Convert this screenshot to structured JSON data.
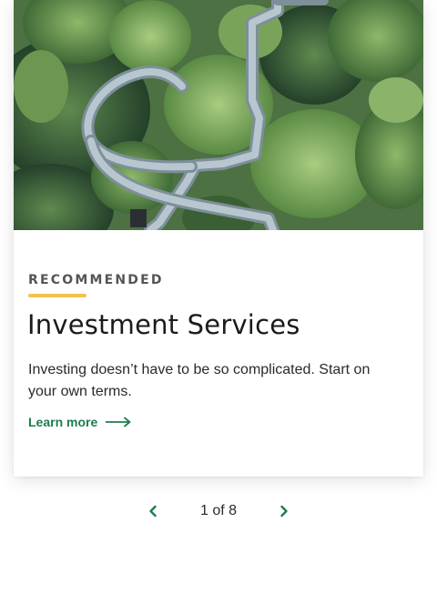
{
  "card": {
    "image_alt": "Aerial view of a winding walkway through a forest canopy",
    "eyebrow": "RECOMMENDED",
    "title": "Investment Services",
    "description": "Investing doesn’t have to be so complicated. Start on your own terms.",
    "link_label": "Learn more",
    "link_icon": "arrow-right-icon"
  },
  "pager": {
    "status": "1 of 8",
    "current": 1,
    "total": 8,
    "prev_icon": "chevron-left-icon",
    "next_icon": "chevron-right-icon"
  },
  "colors": {
    "accent_green": "#1d7d4a",
    "eyebrow_underline": "#f3c24f",
    "text_dark": "#1b1b1b"
  }
}
